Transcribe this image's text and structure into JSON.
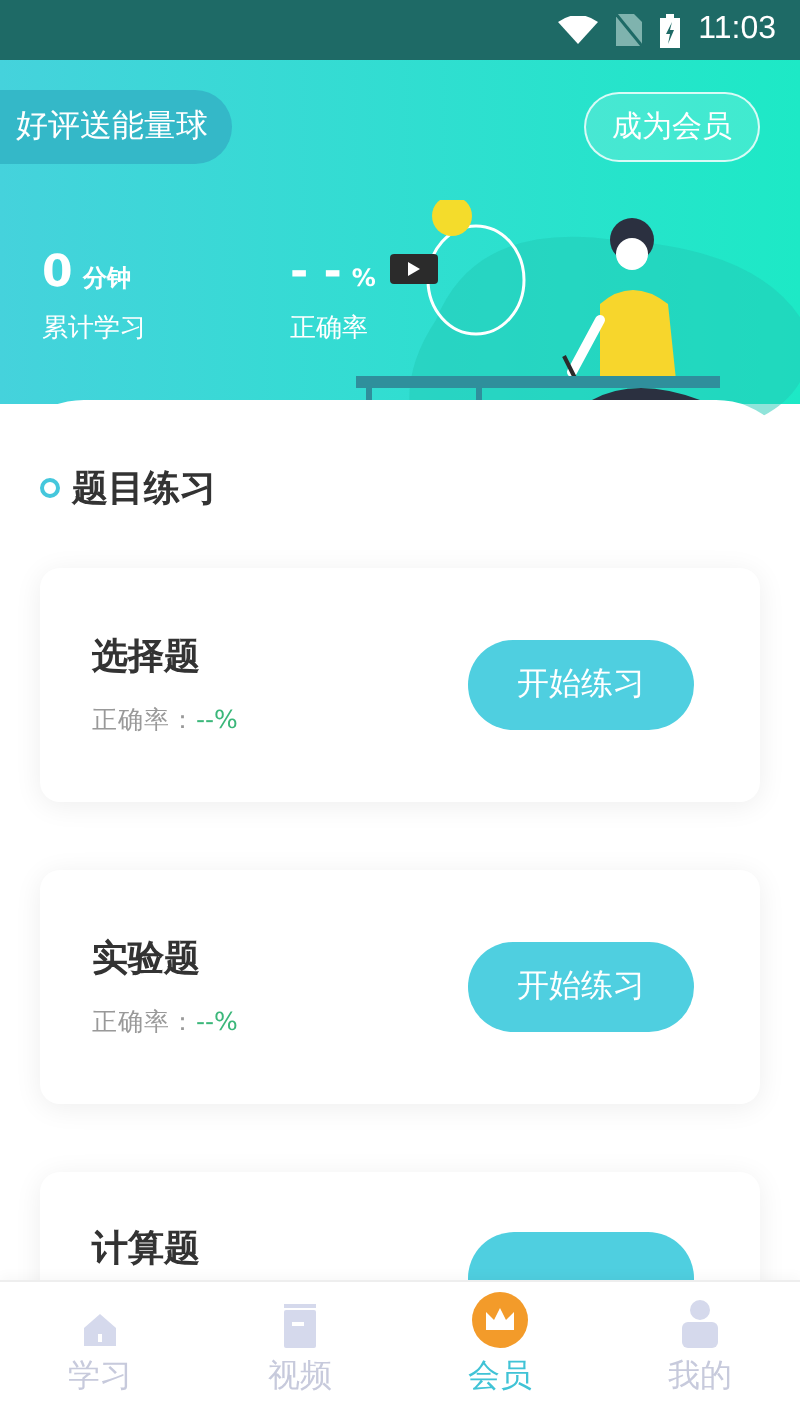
{
  "status_bar": {
    "time": "11:03"
  },
  "header": {
    "promo": "好评送能量球",
    "member_button": "成为会员",
    "stats": [
      {
        "value": "0",
        "unit": "分钟",
        "label": "累计学习"
      },
      {
        "value": "- -",
        "unit": "%",
        "label": "正确率"
      }
    ]
  },
  "section": {
    "title": "题目练习"
  },
  "cards": [
    {
      "kind": "full",
      "title": "选择题",
      "accuracy_label": "正确率：",
      "accuracy_value": "--%",
      "button": "开始练习"
    },
    {
      "kind": "full",
      "title": "实验题",
      "accuracy_label": "正确率：",
      "accuracy_value": "--%",
      "button": "开始练习"
    },
    {
      "kind": "partial",
      "title": "计算题"
    }
  ],
  "tabs": [
    {
      "label": "学习",
      "kind": "home",
      "selected": false
    },
    {
      "label": "视频",
      "kind": "book",
      "selected": false
    },
    {
      "label": "会员",
      "kind": "crown",
      "selected": true
    },
    {
      "label": "我的",
      "kind": "person",
      "selected": false
    }
  ]
}
